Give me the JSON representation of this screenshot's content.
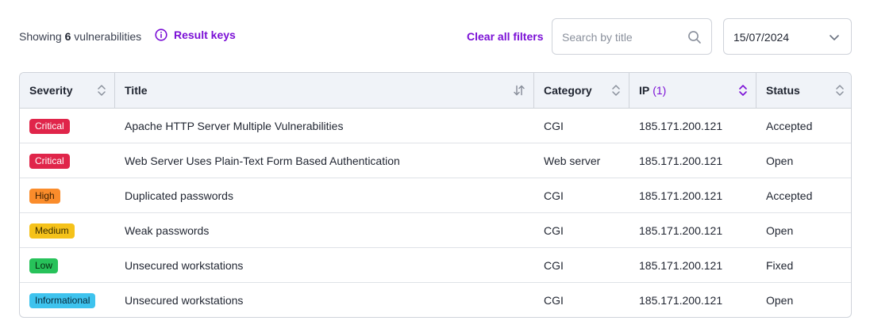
{
  "summary": {
    "prefix": "Showing",
    "count": "6",
    "suffix": "vulnerabilities"
  },
  "result_keys_label": "Result keys",
  "clear_filters_label": "Clear all filters",
  "search": {
    "placeholder": "Search by title",
    "value": ""
  },
  "date_filter": {
    "value": "15/07/2024"
  },
  "columns": [
    {
      "label": "Severity",
      "sort": "neutral"
    },
    {
      "label": "Title",
      "sort": "neutral"
    },
    {
      "label": "Category",
      "sort": "neutral"
    },
    {
      "label": "IP",
      "filter_count": "(1)",
      "sort": "active"
    },
    {
      "label": "Status",
      "sort": "neutral"
    }
  ],
  "rows": [
    {
      "severity": "Critical",
      "title": "Apache HTTP Server Multiple Vulnerabilities",
      "category": "CGI",
      "ip": "185.171.200.121",
      "status": "Accepted"
    },
    {
      "severity": "Critical",
      "title": "Web Server Uses Plain-Text Form Based Authentication",
      "category": "Web server",
      "ip": "185.171.200.121",
      "status": "Open"
    },
    {
      "severity": "High",
      "title": "Duplicated passwords",
      "category": "CGI",
      "ip": "185.171.200.121",
      "status": "Accepted"
    },
    {
      "severity": "Medium",
      "title": "Weak passwords",
      "category": "CGI",
      "ip": "185.171.200.121",
      "status": "Open"
    },
    {
      "severity": "Low",
      "title": "Unsecured workstations",
      "category": "CGI",
      "ip": "185.171.200.121",
      "status": "Fixed"
    },
    {
      "severity": "Informational",
      "title": "Unsecured workstations",
      "category": "CGI",
      "ip": "185.171.200.121",
      "status": "Open"
    }
  ],
  "severity_colors": {
    "Critical": {
      "bg": "#e0254a",
      "fg": "#ffffff"
    },
    "High": {
      "bg": "#fa8c2b",
      "fg": "#3a1e00"
    },
    "Medium": {
      "bg": "#f5c21a",
      "fg": "#3a2c00"
    },
    "Low": {
      "bg": "#27c25a",
      "fg": "#06290f"
    },
    "Informational": {
      "bg": "#3ec3ee",
      "fg": "#06283a"
    }
  },
  "accent_color": "#7b10d6"
}
